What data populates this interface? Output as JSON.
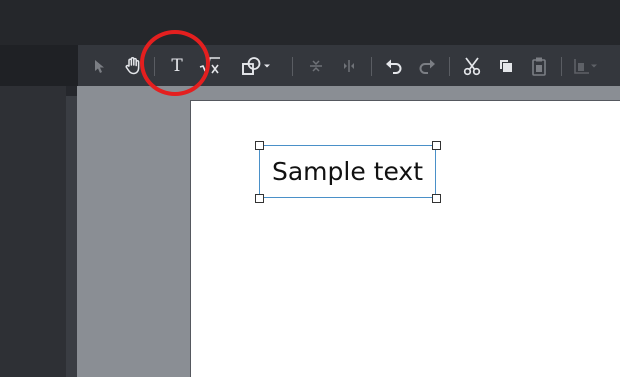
{
  "toolbar": {
    "tools": [
      {
        "name": "select-tool",
        "icon": "arrow-pointer-icon",
        "enabled": false
      },
      {
        "name": "pan-tool",
        "icon": "hand-icon",
        "enabled": true
      },
      {
        "name": "text-tool",
        "icon": "text-T-icon",
        "glyph": "T",
        "enabled": true
      },
      {
        "name": "formula-tool",
        "icon": "square-root-icon",
        "enabled": true
      },
      {
        "name": "shapes-tool",
        "icon": "shapes-icon",
        "enabled": true
      },
      {
        "name": "align-vertical",
        "icon": "align-vertical-icon",
        "enabled": false
      },
      {
        "name": "align-horizontal",
        "icon": "align-horizontal-icon",
        "enabled": false
      },
      {
        "name": "undo",
        "icon": "undo-icon",
        "enabled": true
      },
      {
        "name": "redo",
        "icon": "redo-icon",
        "enabled": false
      },
      {
        "name": "cut",
        "icon": "scissors-icon",
        "enabled": true
      },
      {
        "name": "copy",
        "icon": "copy-icon",
        "enabled": true
      },
      {
        "name": "paste",
        "icon": "clipboard-icon",
        "enabled": false
      },
      {
        "name": "arrange",
        "icon": "arrange-icon",
        "enabled": false
      }
    ]
  },
  "canvas": {
    "textbox": {
      "text": "Sample text"
    }
  },
  "colors": {
    "highlight": "#e41f1f",
    "selection_border": "#4a90c8",
    "toolbar_bg": "#34373d",
    "canvas_bg": "#8a8e94"
  }
}
